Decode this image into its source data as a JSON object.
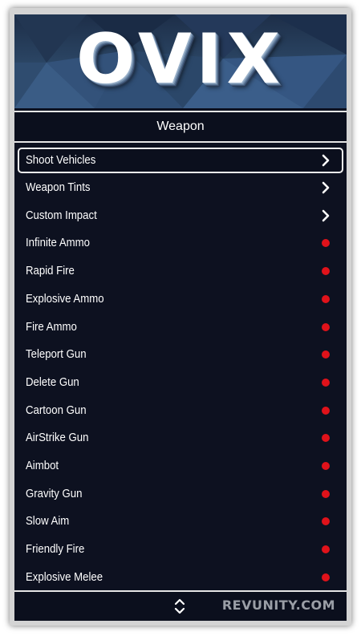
{
  "menu": {
    "logo_text": "OVIX",
    "title": "Weapon",
    "accent_color": "#e0121a",
    "items": [
      {
        "label": "Shoot Vehicles",
        "type": "submenu",
        "selected": true
      },
      {
        "label": "Weapon Tints",
        "type": "submenu",
        "selected": false
      },
      {
        "label": "Custom Impact",
        "type": "submenu",
        "selected": false
      },
      {
        "label": "Infinite Ammo",
        "type": "toggle",
        "state": "off"
      },
      {
        "label": "Rapid Fire",
        "type": "toggle",
        "state": "off"
      },
      {
        "label": "Explosive Ammo",
        "type": "toggle",
        "state": "off"
      },
      {
        "label": "Fire Ammo",
        "type": "toggle",
        "state": "off"
      },
      {
        "label": "Teleport Gun",
        "type": "toggle",
        "state": "off"
      },
      {
        "label": "Delete Gun",
        "type": "toggle",
        "state": "off"
      },
      {
        "label": "Cartoon Gun",
        "type": "toggle",
        "state": "off"
      },
      {
        "label": "AirStrike Gun",
        "type": "toggle",
        "state": "off"
      },
      {
        "label": "Aimbot",
        "type": "toggle",
        "state": "off"
      },
      {
        "label": "Gravity Gun",
        "type": "toggle",
        "state": "off"
      },
      {
        "label": "Slow Aim",
        "type": "toggle",
        "state": "off"
      },
      {
        "label": "Friendly Fire",
        "type": "toggle",
        "state": "off"
      },
      {
        "label": "Explosive Melee",
        "type": "toggle",
        "state": "off"
      }
    ],
    "footer": {
      "scroll_icon": "up-down-arrows-icon",
      "watermark": "REVUNITY.COM"
    }
  }
}
